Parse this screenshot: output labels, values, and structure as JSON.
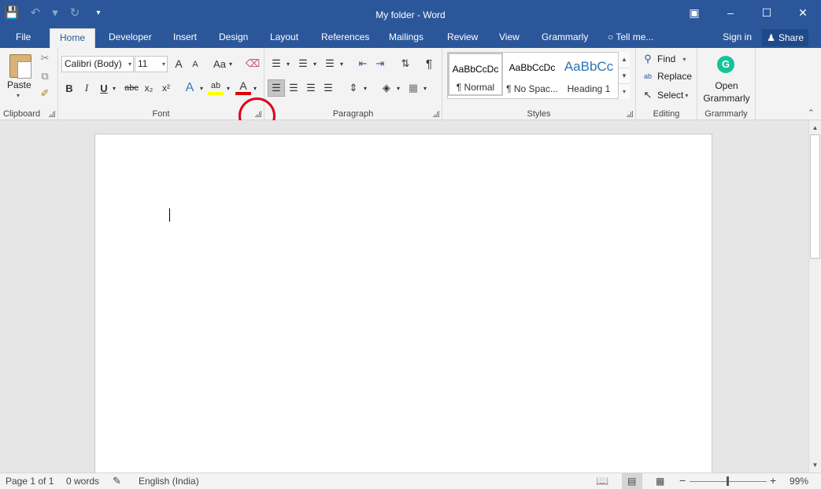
{
  "window": {
    "title": "My folder - Word"
  },
  "tabs": [
    "File",
    "Home",
    "Developer",
    "Insert",
    "Design",
    "Layout",
    "References",
    "Mailings",
    "Review",
    "View",
    "Grammarly",
    "Tell me..."
  ],
  "account": {
    "signin": "Sign in",
    "share": "Share"
  },
  "clipboard": {
    "paste": "Paste",
    "label": "Clipboard"
  },
  "font": {
    "name": "Calibri (Body)",
    "size": "11",
    "label": "Font",
    "bold": "B",
    "italic": "I",
    "underline": "U",
    "strike": "abc",
    "sub": "x₂",
    "sup": "x²",
    "grow": "A",
    "shrink": "A",
    "case": "Aa"
  },
  "paragraph": {
    "label": "Paragraph",
    "pilcrow": "¶"
  },
  "styles": {
    "label": "Styles",
    "items": [
      {
        "preview": "AaBbCcDc",
        "name": "¶ Normal"
      },
      {
        "preview": "AaBbCcDc",
        "name": "¶ No Spac..."
      },
      {
        "preview": "AaBbCc",
        "name": "Heading 1"
      }
    ]
  },
  "editing": {
    "label": "Editing",
    "find": "Find",
    "replace": "Replace",
    "select": "Select"
  },
  "grammarly": {
    "label": "Grammarly",
    "open": "Open",
    "name": "Grammarly",
    "logo": "G"
  },
  "statusbar": {
    "page": "Page 1 of 1",
    "words": "0 words",
    "language": "English (India)",
    "zoom": "99%"
  }
}
